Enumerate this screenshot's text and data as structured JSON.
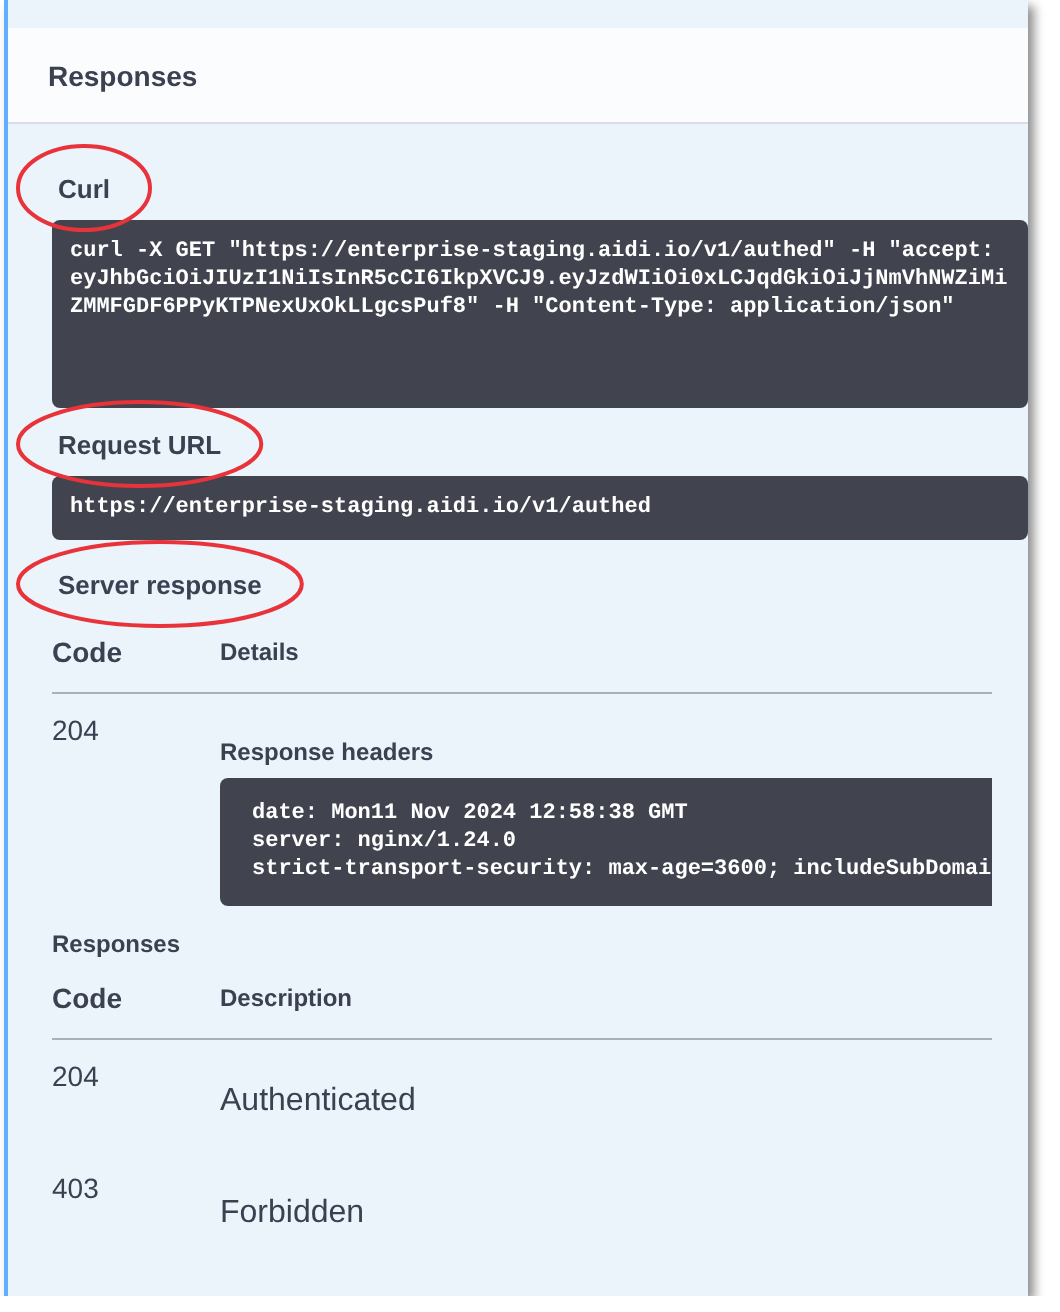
{
  "section_title": "Responses",
  "curl": {
    "label": "Curl",
    "highlighted": true,
    "lines": [
      "curl -X GET \"https://enterprise-staging.aidi.io/v1/authed\" -H \"accept:",
      "eyJhbGciOiJIUzI1NiIsInR5cCI6IkpXVCJ9.eyJzdWIiOi0xLCJqdGkiOiJjNmVhNWZiMi",
      "ZMMFGDF6PPyKTPNexUxOkLLgcsPuf8\" -H \"Content-Type: application/json\""
    ]
  },
  "request_url": {
    "label": "Request URL",
    "highlighted": true,
    "value": "https://enterprise-staging.aidi.io/v1/authed"
  },
  "server_response": {
    "label": "Server response",
    "highlighted": true,
    "columns": [
      "Code",
      "Details"
    ],
    "rows": [
      {
        "code": "204",
        "headers_label": "Response headers",
        "headers": [
          "date: Mon11 Nov 2024 12:58:38 GMT",
          "server: nginx/1.24.0",
          "strict-transport-security: max-age=3600; includeSubDomai"
        ]
      }
    ]
  },
  "responses": {
    "title": "Responses",
    "columns": [
      "Code",
      "Description"
    ],
    "rows": [
      {
        "code": "204",
        "description": "Authenticated"
      },
      {
        "code": "403",
        "description": "Forbidden"
      }
    ]
  }
}
